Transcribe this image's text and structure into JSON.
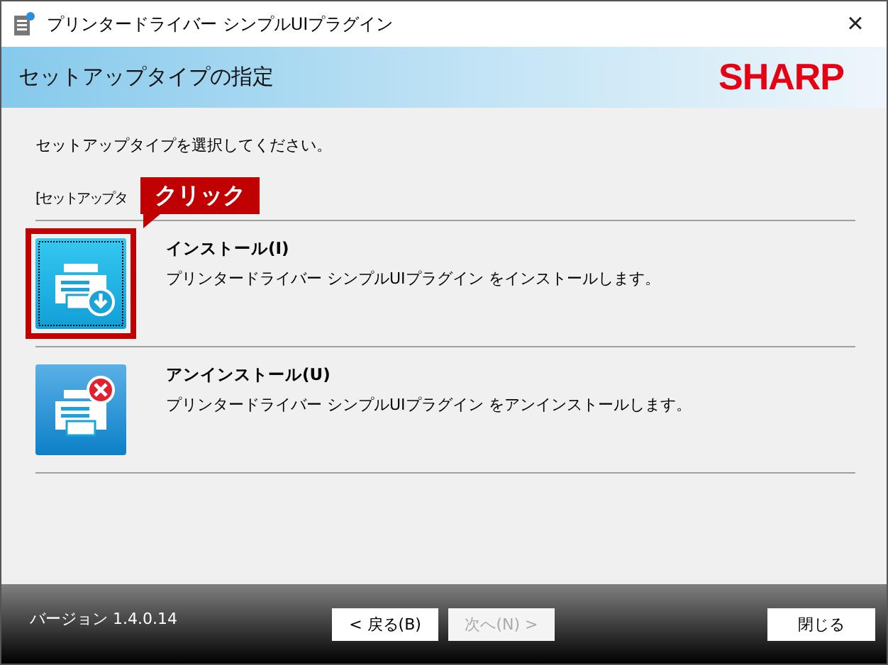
{
  "window": {
    "title": "プリンタードライバー シンプルUIプラグイン",
    "close": "×"
  },
  "header": {
    "title": "セットアップタイプの指定",
    "logo": "SHARP"
  },
  "instruction": "セットアップタイプを選択してください。",
  "section_label": "[セットアップタ",
  "callout": {
    "label": "クリック"
  },
  "options": [
    {
      "kind": "install",
      "title": "インストール(I)",
      "description": "プリンタードライバー シンプルUIプラグイン をインストールします。",
      "selected": true
    },
    {
      "kind": "uninstall",
      "title": "アンインストール(U)",
      "description": "プリンタードライバー シンプルUIプラグイン をアンインストールします。",
      "selected": false
    }
  ],
  "footer": {
    "version": "バージョン 1.4.0.14",
    "buttons": [
      {
        "label": "< 戻る(B)",
        "disabled": false
      },
      {
        "label": "次へ(N) >",
        "disabled": true
      }
    ],
    "close": "閉じる"
  }
}
